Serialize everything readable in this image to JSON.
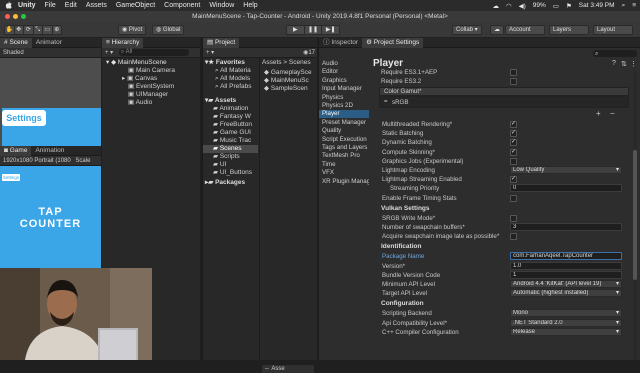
{
  "menubar": {
    "apple": "",
    "items": [
      "Unity",
      "File",
      "Edit",
      "Assets",
      "GameObject",
      "Component",
      "Window",
      "Help"
    ],
    "battery": "99%",
    "clock": "Sat 3:49 PM"
  },
  "window": {
    "title": "MainMenuScene - Tap-Counter - Android - Unity 2019.4.8f1 Personal (Personal) <Metal>"
  },
  "toolbar": {
    "pivot": "Pivot",
    "global": "Global",
    "collab": "Collab ▾",
    "account": "Account",
    "layers": "Layers",
    "layout": "Layout"
  },
  "scene_panel": {
    "tabs": [
      "Scene",
      "Animator"
    ],
    "shading": "Shaded",
    "banner_text": "Settings"
  },
  "game_panel": {
    "tabs": [
      "Game",
      "Animation"
    ],
    "resolution": "1920x1080 Portrait (1080",
    "scale": "Scale",
    "badge": "Settings",
    "title_line1": "TAP",
    "title_line2": "COUNTER"
  },
  "hierarchy": {
    "tab": "Hierarchy",
    "search_placeholder": "All",
    "add_label": "+ ▾",
    "items": [
      "MainMenuScene",
      "Main Camera",
      "Canvas",
      "EventSystem",
      "UIManager",
      "Audio"
    ]
  },
  "project": {
    "tab": "Project",
    "add_label": "+ ▾",
    "count_badge": "17",
    "favorites_label": "Favorites",
    "favorites": [
      "All Materia",
      "All Models",
      "All Prefabs"
    ],
    "assets_label": "Assets",
    "folders": [
      "Animation",
      "Fantasy W",
      "FreeButton",
      "Game GUI",
      "Music Trac",
      "Scenes",
      "Scripts",
      "UI",
      "UI_Buttons"
    ],
    "packages_label": "Packages",
    "breadcrumb": "Assets > Scenes",
    "files": [
      "GameplaySce",
      "MainMenuSc",
      "SampleScen"
    ],
    "bottom_label": "Asse"
  },
  "inspector": {
    "tabs": [
      "Inspector",
      "Project Settings"
    ],
    "categories": [
      "Audio",
      "Editor",
      "Graphics",
      "Input Manager",
      "Physics",
      "Physics 2D",
      "Player",
      "Preset Manager",
      "Quality",
      "Script Execution",
      "Tags and Layers",
      "TextMesh Pro",
      "Time",
      "VFX",
      "XR Plugin Manag"
    ],
    "selected_category": "Player",
    "header": "Player",
    "top_items": [
      "Require ES3.1+AEP",
      "Require ES3.2"
    ],
    "color_gamut_label": "Color Gamut*",
    "color_gamut_value": "sRGB",
    "list_add": "+",
    "list_remove": "−",
    "settings": [
      {
        "label": "Multithreaded Rendering*",
        "kind": "check",
        "checked": true
      },
      {
        "label": "Static Batching",
        "kind": "check",
        "checked": true
      },
      {
        "label": "Dynamic Batching",
        "kind": "check",
        "checked": true
      },
      {
        "label": "Compute Skinning*",
        "kind": "check",
        "checked": true
      },
      {
        "label": "Graphics Jobs (Experimental)",
        "kind": "check",
        "checked": false
      },
      {
        "label": "Lightmap Encoding",
        "kind": "dropdown",
        "value": "Low Quality"
      },
      {
        "label": "Lightmap Streaming Enabled",
        "kind": "check",
        "checked": true
      },
      {
        "label": "Streaming Priority",
        "kind": "field",
        "value": "0"
      },
      {
        "label": "Enable Frame Timing Stats",
        "kind": "check",
        "checked": false
      }
    ],
    "vulkan_header": "Vulkan Settings",
    "vulkan": [
      {
        "label": "SRGB Write Mode*",
        "kind": "check",
        "checked": false
      },
      {
        "label": "Number of swapchain buffers*",
        "kind": "field",
        "value": "3"
      },
      {
        "label": "Acquire swapchain image late as possible*",
        "kind": "check",
        "checked": false
      }
    ],
    "identification_header": "Identification",
    "identification": [
      {
        "label": "Package Name",
        "kind": "field",
        "value": "com.FarhanAqeel.TapCounter"
      },
      {
        "label": "Version*",
        "kind": "field",
        "value": "1.0"
      },
      {
        "label": "Bundle Version Code",
        "kind": "field",
        "value": "1"
      },
      {
        "label": "Minimum API Level",
        "kind": "dropdown",
        "value": "Android 4.4 'KitKat' (API level 19)"
      },
      {
        "label": "Target API Level",
        "kind": "dropdown",
        "value": "Automatic (highest installed)"
      }
    ],
    "configuration_header": "Configuration",
    "configuration": [
      {
        "label": "Scripting Backend",
        "kind": "dropdown",
        "value": "Mono"
      },
      {
        "label": "Api Compatibility Level*",
        "kind": "dropdown",
        "value": ".NET Standard 2.0"
      },
      {
        "label": "C++ Compiler Configuration",
        "kind": "dropdown",
        "value": "Release"
      }
    ]
  },
  "colors": {
    "game_blue": "#3aa6e8",
    "selection": "#2c5d87",
    "package_highlight": "#3d6fa8"
  }
}
